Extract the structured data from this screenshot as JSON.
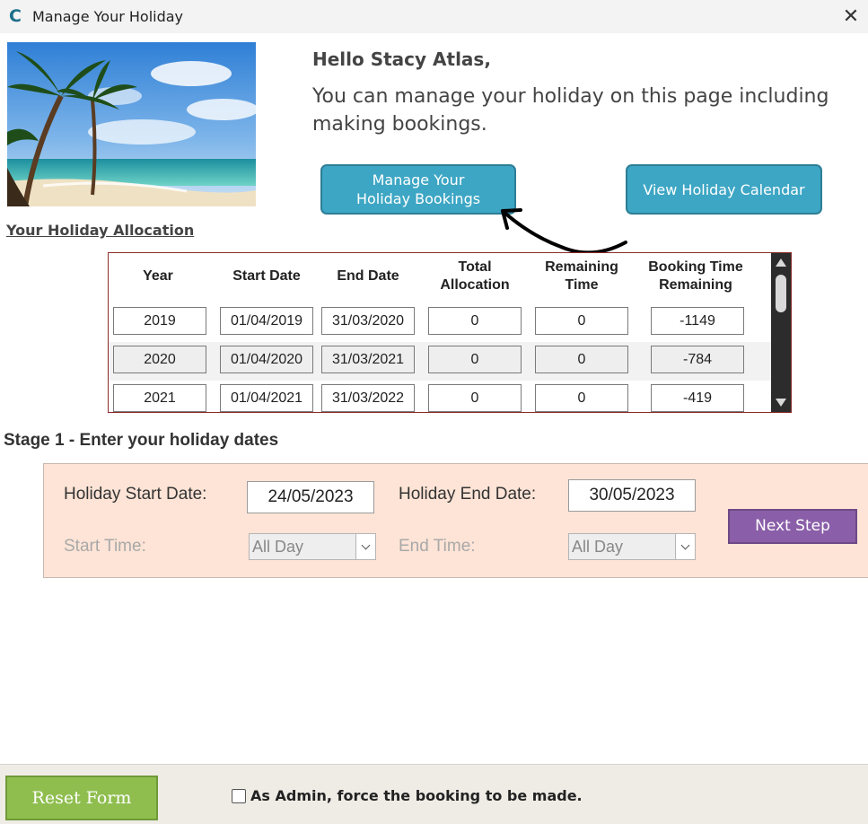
{
  "window": {
    "title": "Manage Your Holiday",
    "logo_letter": "C",
    "close_glyph": "✕"
  },
  "header": {
    "greeting": "Hello Stacy Atlas,",
    "intro": "You can manage your holiday on this page including making bookings.",
    "manage_button": "Manage Your Holiday Bookings",
    "calendar_button": "View Holiday Calendar"
  },
  "allocation": {
    "link_label": "Your Holiday Allocation",
    "columns": [
      "Year",
      "Start Date",
      "End Date",
      "Total Allocation",
      "Remaining Time",
      "Booking Time Remaining"
    ],
    "rows": [
      [
        "2019",
        "01/04/2019",
        "31/03/2020",
        "0",
        "0",
        "-1149"
      ],
      [
        "2020",
        "01/04/2020",
        "31/03/2021",
        "0",
        "0",
        "-784"
      ],
      [
        "2021",
        "01/04/2021",
        "31/03/2022",
        "0",
        "0",
        "-419"
      ]
    ]
  },
  "stage1": {
    "title": "Stage 1 - Enter your holiday dates",
    "start_date_label": "Holiday Start Date:",
    "start_date_value": "24/05/2023",
    "end_date_label": "Holiday End Date:",
    "end_date_value": "30/05/2023",
    "start_time_label": "Start Time:",
    "start_time_value": "All Day",
    "end_time_label": "End Time:",
    "end_time_value": "All Day",
    "next_button": "Next Step"
  },
  "footer": {
    "reset_button": "Reset Form",
    "admin_label": "As Admin, force the booking to be made.",
    "admin_checked": false
  },
  "colors": {
    "teal_button": "#3da6c4",
    "purple_button": "#8a5ea8",
    "green_button": "#8fbe4f",
    "stage_panel": "#fde4d6",
    "table_border": "#8b2b2b"
  }
}
